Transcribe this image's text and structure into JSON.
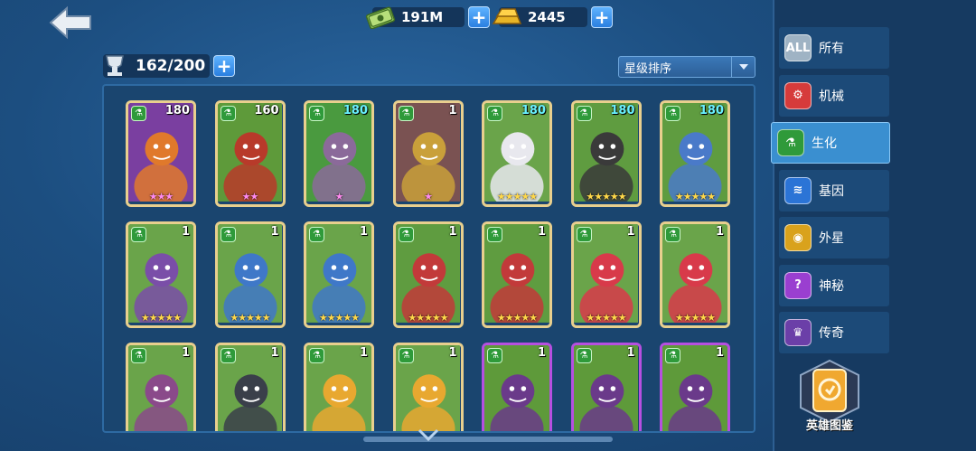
{
  "resources": {
    "cash": "191M",
    "gold": "2445"
  },
  "roster": {
    "count": "162/200"
  },
  "sort": {
    "label": "星级排序"
  },
  "categories": [
    {
      "label": "所有",
      "icon": "all-icon",
      "icon_text": "ALL",
      "color": "#9fb3c4"
    },
    {
      "label": "机械",
      "icon": "mechanical-icon",
      "icon_text": "⚙",
      "color": "#d63b3b"
    },
    {
      "label": "生化",
      "icon": "biochemical-icon",
      "icon_text": "⚗",
      "color": "#2f9a3a",
      "active": true
    },
    {
      "label": "基因",
      "icon": "gene-icon",
      "icon_text": "≋",
      "color": "#2b74d6"
    },
    {
      "label": "外星",
      "icon": "alien-icon",
      "icon_text": "◉",
      "color": "#d9a21c"
    },
    {
      "label": "神秘",
      "icon": "mystic-icon",
      "icon_text": "?",
      "color": "#9a3fd0"
    },
    {
      "label": "传奇",
      "icon": "legend-icon",
      "icon_text": "♛",
      "color": "#6b3fa8"
    }
  ],
  "album": {
    "label": "英雄图鉴"
  },
  "heroes": [
    {
      "level": "180",
      "stars": "★★★",
      "star_color": "pink",
      "frame": "gold",
      "bg": "#7a3fa0",
      "fg": "#e0792b"
    },
    {
      "level": "160",
      "stars": "★★",
      "star_color": "pink",
      "frame": "gold",
      "bg": "#5e9a3a",
      "fg": "#b83a2a"
    },
    {
      "level": "180",
      "stars": "★",
      "star_color": "pink",
      "frame": "gold",
      "bg": "#4a9a3f",
      "fg": "#8b6a9a"
    },
    {
      "level": "1",
      "stars": "★",
      "star_color": "pink",
      "frame": "gold",
      "bg": "#7a5252",
      "fg": "#c9a03a"
    },
    {
      "level": "180",
      "stars": "★★★★★",
      "star_color": "gold",
      "frame": "gold",
      "bg": "#6aa44a",
      "fg": "#e8e8ee"
    },
    {
      "level": "180",
      "stars": "★★★★★",
      "star_color": "gold",
      "frame": "gold",
      "bg": "#5f9c40",
      "fg": "#3a3a3a"
    },
    {
      "level": "180",
      "stars": "★★★★★",
      "star_color": "gold",
      "frame": "gold",
      "bg": "#5f9c40",
      "fg": "#4a7ac9"
    },
    {
      "level": "1",
      "stars": "★★★★★",
      "star_color": "gold",
      "frame": "gold",
      "bg": "#6aa44a",
      "fg": "#7a4ea8"
    },
    {
      "level": "1",
      "stars": "★★★★★",
      "star_color": "gold",
      "frame": "gold",
      "bg": "#6aa44a",
      "fg": "#3f78c8"
    },
    {
      "level": "1",
      "stars": "★★★★★",
      "star_color": "gold",
      "frame": "gold",
      "bg": "#6aa44a",
      "fg": "#3f78c8"
    },
    {
      "level": "1",
      "stars": "★★★★★",
      "star_color": "gold",
      "frame": "gold",
      "bg": "#5f9c40",
      "fg": "#c23a3a"
    },
    {
      "level": "1",
      "stars": "★★★★★",
      "star_color": "gold",
      "frame": "gold",
      "bg": "#5f9c40",
      "fg": "#c23a3a"
    },
    {
      "level": "1",
      "stars": "★★★★★",
      "star_color": "gold",
      "frame": "gold",
      "bg": "#6aa44a",
      "fg": "#d83a4a"
    },
    {
      "level": "1",
      "stars": "★★★★★",
      "star_color": "gold",
      "frame": "gold",
      "bg": "#6aa44a",
      "fg": "#d83a4a"
    },
    {
      "level": "1",
      "stars": "",
      "star_color": "gold",
      "frame": "gold",
      "bg": "#6aa44a",
      "fg": "#8a4a8a"
    },
    {
      "level": "1",
      "stars": "",
      "star_color": "gold",
      "frame": "gold",
      "bg": "#6aa44a",
      "fg": "#3a3f4a"
    },
    {
      "level": "1",
      "stars": "",
      "star_color": "gold",
      "frame": "gold",
      "bg": "#6aa44a",
      "fg": "#e8a830"
    },
    {
      "level": "1",
      "stars": "",
      "star_color": "gold",
      "frame": "gold",
      "bg": "#6aa44a",
      "fg": "#e8a830"
    },
    {
      "level": "1",
      "stars": "",
      "star_color": "gold",
      "frame": "purple",
      "bg": "#5e9a3a",
      "fg": "#6a3a8a"
    },
    {
      "level": "1",
      "stars": "",
      "star_color": "gold",
      "frame": "purple",
      "bg": "#5e9a3a",
      "fg": "#6a3a8a"
    },
    {
      "level": "1",
      "stars": "",
      "star_color": "gold",
      "frame": "purple",
      "bg": "#5e9a3a",
      "fg": "#6a3a8a"
    }
  ]
}
